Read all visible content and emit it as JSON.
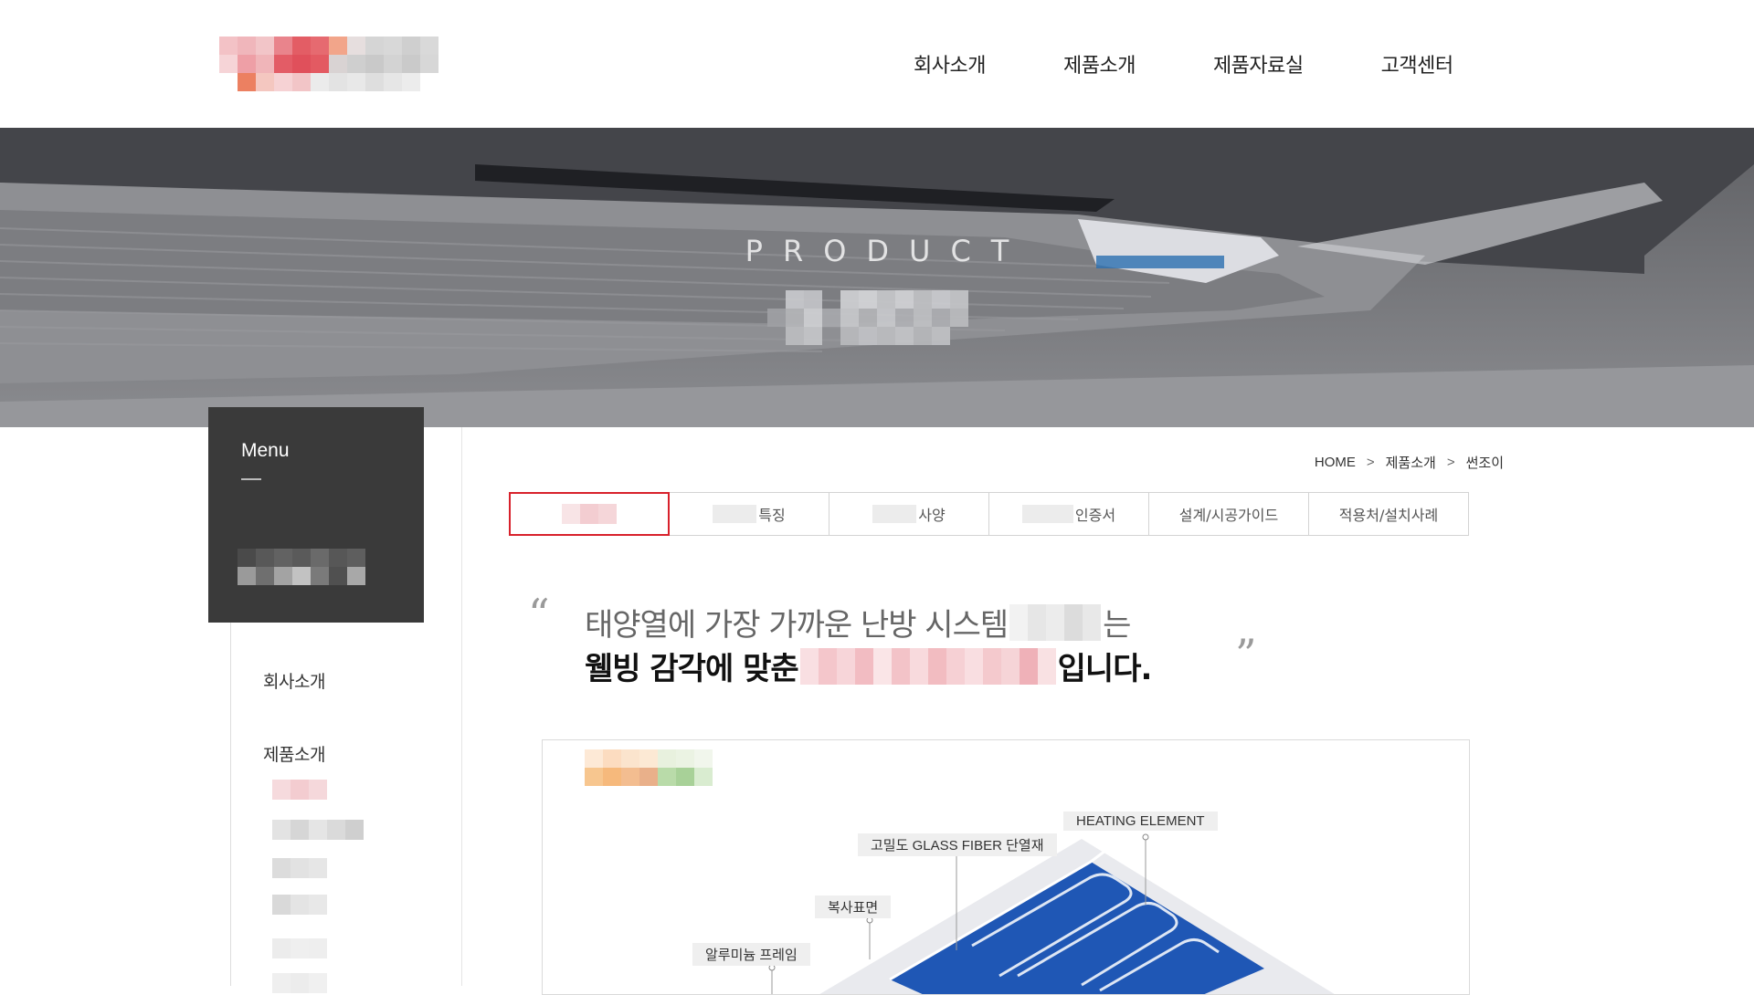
{
  "header": {
    "nav": [
      "회사소개",
      "제품소개",
      "제품자료실",
      "고객센터"
    ]
  },
  "hero": {
    "title": "PRODUCT"
  },
  "sidebar": {
    "menu_title": "Menu",
    "items": [
      "회사소개",
      "제품소개"
    ]
  },
  "breadcrumb": {
    "home": "HOME",
    "sep": ">",
    "level1": "제품소개",
    "level2": "썬조이"
  },
  "tabs": {
    "features": "특징",
    "specs": "사양",
    "certs": "인증서",
    "design_guide": "설계/시공가이드",
    "cases": "적용처/설치사례"
  },
  "quote": {
    "line1_prefix": "태양열에 가장 가까운 난방 시스템",
    "line1_suffix": "는",
    "line2_prefix": "웰빙 감각에 맞춘",
    "line2_suffix": "입니다."
  },
  "diagram": {
    "labels": {
      "heating": "HEATING ELEMENT",
      "glass": "고밀도 GLASS FIBER 단열재",
      "radiant": "복사표면",
      "frame": "알루미늄 프레임"
    }
  },
  "colors": {
    "accent": "#d8212b",
    "sidebar_bg": "#3a3a3a",
    "panel_blue": "#1f57b5"
  }
}
